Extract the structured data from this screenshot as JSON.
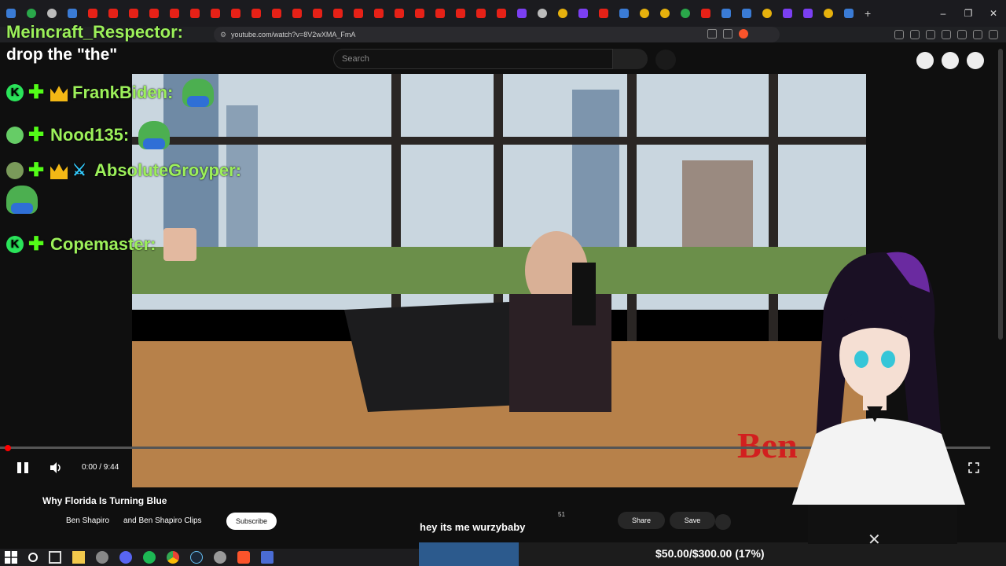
{
  "browser": {
    "url": "youtube.com/watch?v=8V2wXMA_FmA",
    "window_controls": {
      "minimize": "–",
      "maximize": "❐",
      "close": "✕"
    },
    "new_tab": "+"
  },
  "youtube": {
    "search_placeholder": "Search",
    "video_title": "Why Florida Is Turning Blue",
    "channel_primary": "Ben Shapiro",
    "channel_secondary": "and Ben Shapiro Clips",
    "subscribe_label": "Subscribe",
    "like_count": "51",
    "share_label": "Share",
    "save_label": "Save",
    "time_display": "0:00 / 9:44"
  },
  "chat": {
    "messages": [
      {
        "user": "Meincraft_Respector:",
        "text": "drop the \"the\""
      },
      {
        "user": "FrankBiden:"
      },
      {
        "user": "Nood135:"
      },
      {
        "user": "AbsoluteGroyper:"
      },
      {
        "user": "Copemaster:"
      }
    ],
    "badge_k": "K"
  },
  "stream_overlay": {
    "caption": "hey its me wurzybaby",
    "donation_goal": "$50.00/$300.00 (17%)",
    "goal_fraction": 0.17,
    "close_glyph": "✕"
  },
  "colors": {
    "username": "#9cf05a",
    "progress": "#ff0000",
    "goal_fill": "#2c5a8d"
  }
}
